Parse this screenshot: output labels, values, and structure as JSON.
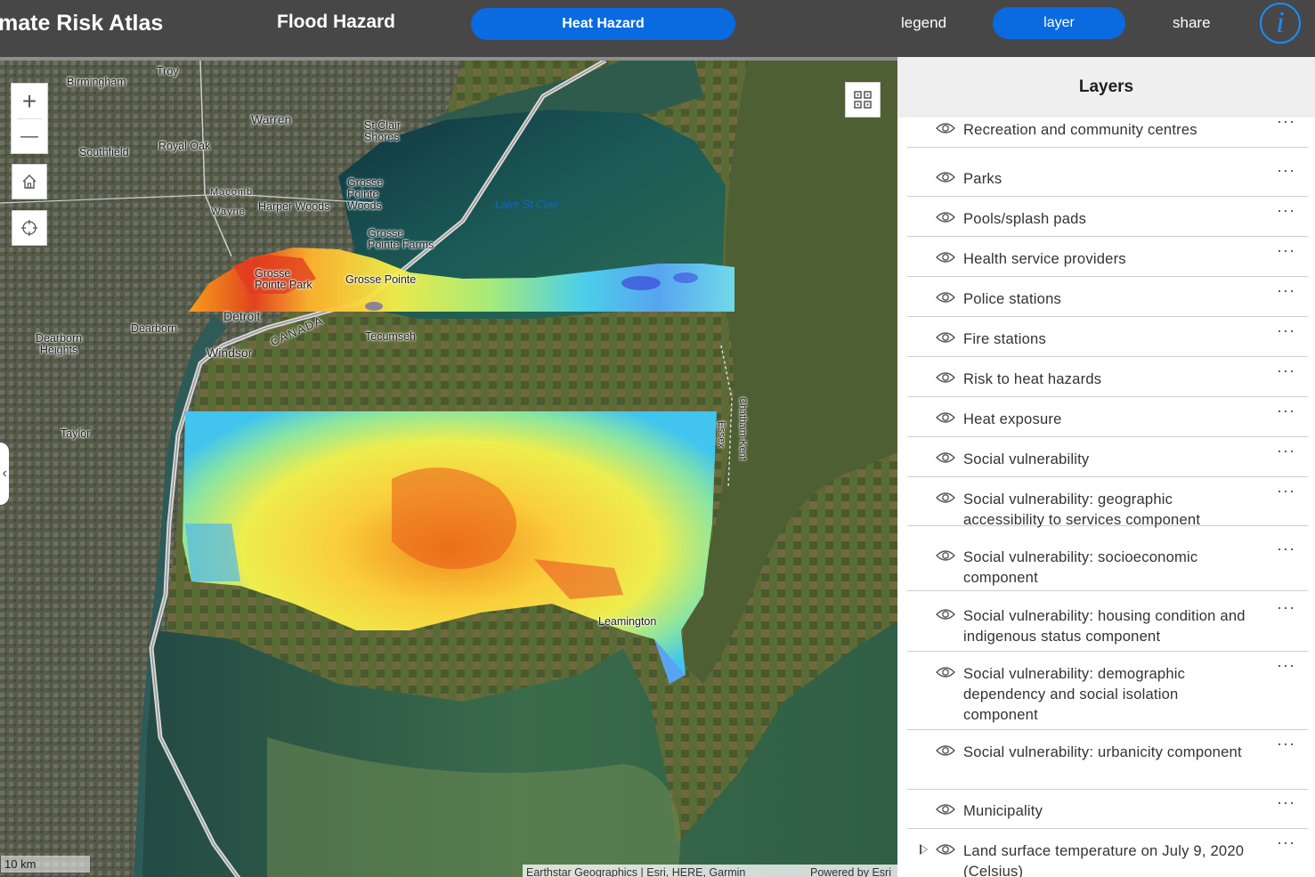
{
  "header": {
    "app_title": "mate Risk Atlas",
    "nav_flood": "Flood Hazard",
    "nav_heat": "Heat Hazard",
    "legend_label": "legend",
    "layer_label": "layer",
    "share_label": "share",
    "info_icon": "i"
  },
  "colors": {
    "topbar": "#474747",
    "accent": "#0a6ae0",
    "info": "#1a8cff"
  },
  "map": {
    "zoom_in": "+",
    "zoom_out": "—",
    "scale_label": "10 km",
    "attribution": "Earthstar Geographics | Esri, HERE, Garmin",
    "powered_by": "Powered by Esri",
    "labels": {
      "birmingham": "Birmingham",
      "troy": "Troy",
      "warren": "Warren",
      "st_clair_shores": "St Clair\nShores",
      "southfield": "Southfield",
      "royal_oak": "Royal Oak",
      "macomb": "Macomb",
      "wayne": "Wayne",
      "harper_woods": "Harper Woods",
      "grosse_pointe_woods": "Grosse\nPointe\nWoods",
      "lake_st_clair": "Lake St Clair",
      "grosse_pointe_farms": "Grosse\nPointe Farms",
      "grosse_pointe_park": "Grosse\nPointe Park",
      "grosse_pointe": "Grosse Pointe",
      "detroit": "Detroit",
      "dearborn": "Dearborn",
      "dearborn_heights": "Dearborn\nHeights",
      "windsor": "Windsor",
      "canada": "CANADA",
      "tecumseh": "Tecumseh",
      "taylor": "Taylor",
      "essex": "Essex",
      "chatham_kent": "Chatham-Kent",
      "leamington": "Leamington"
    }
  },
  "panel": {
    "title": "Layers",
    "layers": [
      {
        "label": "Recreation and community centres"
      },
      {
        "label": "Parks"
      },
      {
        "label": "Pools/splash pads"
      },
      {
        "label": "Health service providers"
      },
      {
        "label": "Police stations"
      },
      {
        "label": "Fire stations"
      },
      {
        "label": "Risk to heat hazards"
      },
      {
        "label": "Heat exposure"
      },
      {
        "label": "Social vulnerability"
      },
      {
        "label": "Social vulnerability: geographic accessibility to services component"
      },
      {
        "label": "Social vulnerability: socioeconomic component"
      },
      {
        "label": "Social vulnerability: housing condition and indigenous status component"
      },
      {
        "label": "Social vulnerability: demographic dependency and social isolation component"
      },
      {
        "label": "Social vulnerability: urbanicity component"
      },
      {
        "label": "Municipality"
      },
      {
        "label": "Land surface temperature on July 9, 2020 (Celsius)"
      }
    ],
    "more_glyph": "···"
  }
}
